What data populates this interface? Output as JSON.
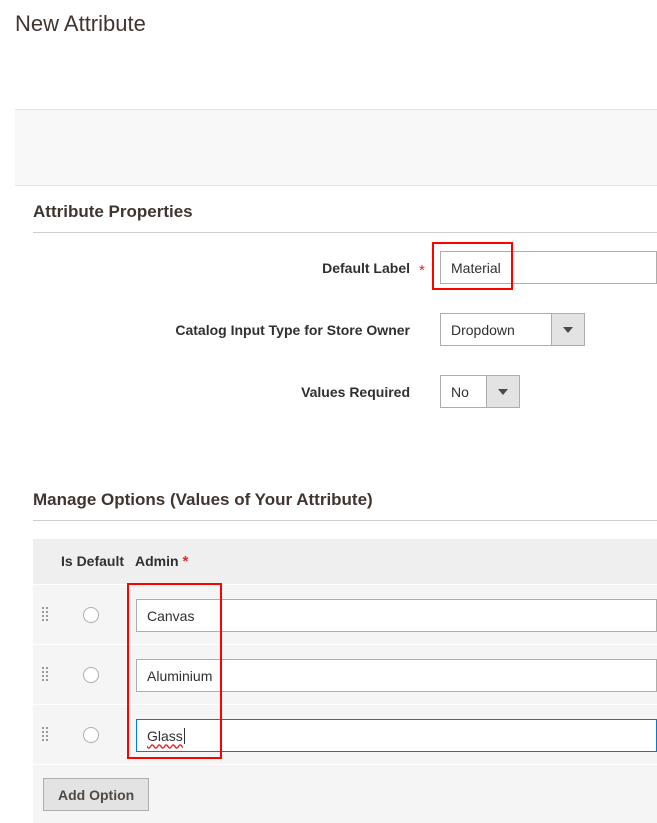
{
  "page": {
    "title": "New Attribute"
  },
  "attribute_properties": {
    "title": "Attribute Properties",
    "default_label": {
      "label": "Default Label",
      "value": "Material"
    },
    "input_type": {
      "label": "Catalog Input Type for Store Owner",
      "value": "Dropdown"
    },
    "values_required": {
      "label": "Values Required",
      "value": "No"
    }
  },
  "manage_options": {
    "title": "Manage Options (Values of Your Attribute)",
    "columns": {
      "is_default": "Is Default",
      "admin": "Admin"
    },
    "rows": [
      {
        "value": "Canvas"
      },
      {
        "value": "Aluminium"
      },
      {
        "value": "Glass"
      }
    ],
    "add_button": "Add Option"
  },
  "required_mark": "*",
  "colors": {
    "highlight": "#ff0000",
    "focus": "#007bdb",
    "required": "#e22626"
  }
}
